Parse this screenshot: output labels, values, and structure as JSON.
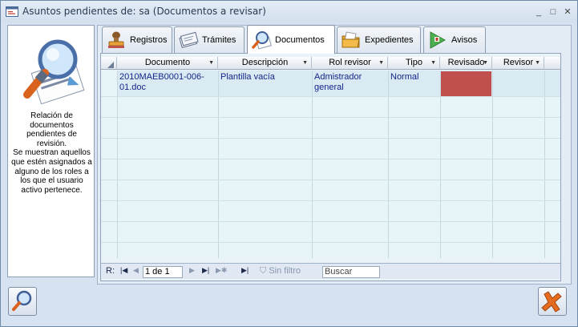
{
  "window": {
    "title": "Asuntos pendientes de: sa (Documentos a revisar)",
    "icon": "form-window-icon",
    "controls": {
      "minimize": "_",
      "maximize": "□",
      "close": "✕"
    }
  },
  "left_panel": {
    "description": "Relación de documentos pendientes de revisión.\nSe muestran aquellos que estén asignados a alguno de los roles a los que el usuario activo pertenece."
  },
  "tabs": [
    {
      "label": "Registros",
      "icon": "stamp-icon",
      "active": false
    },
    {
      "label": "Trámites",
      "icon": "papers-icon",
      "active": false
    },
    {
      "label": "Documentos",
      "icon": "magnifier-document-icon",
      "active": true
    },
    {
      "label": "Expedientes",
      "icon": "folder-icon",
      "active": false
    },
    {
      "label": "Avisos",
      "icon": "alert-icon",
      "active": false
    }
  ],
  "grid": {
    "columns": [
      "Documento",
      "Descripción",
      "Rol revisor",
      "Tipo",
      "Revisado",
      "Revisor"
    ],
    "rows": [
      {
        "documento": "2010MAEB0001-006-01.doc",
        "descripcion": "Plantilla vacía",
        "rol_revisor": "Admistrador general",
        "tipo": "Normal",
        "revisado": "",
        "revisor": ""
      }
    ],
    "status_colors": {
      "revisado_pending": "#c0504d",
      "selected_row": "#d9eaf3"
    }
  },
  "navigation": {
    "record_label": "R:",
    "position": "1 de 1",
    "filter_label": "Sin filtro",
    "search_placeholder": "Buscar"
  },
  "footer": {
    "search_button": "search-magnifier-icon",
    "exit_button": "exit-x-icon"
  },
  "colors": {
    "accent": "#7d8ea6",
    "text_link": "#16258a"
  }
}
